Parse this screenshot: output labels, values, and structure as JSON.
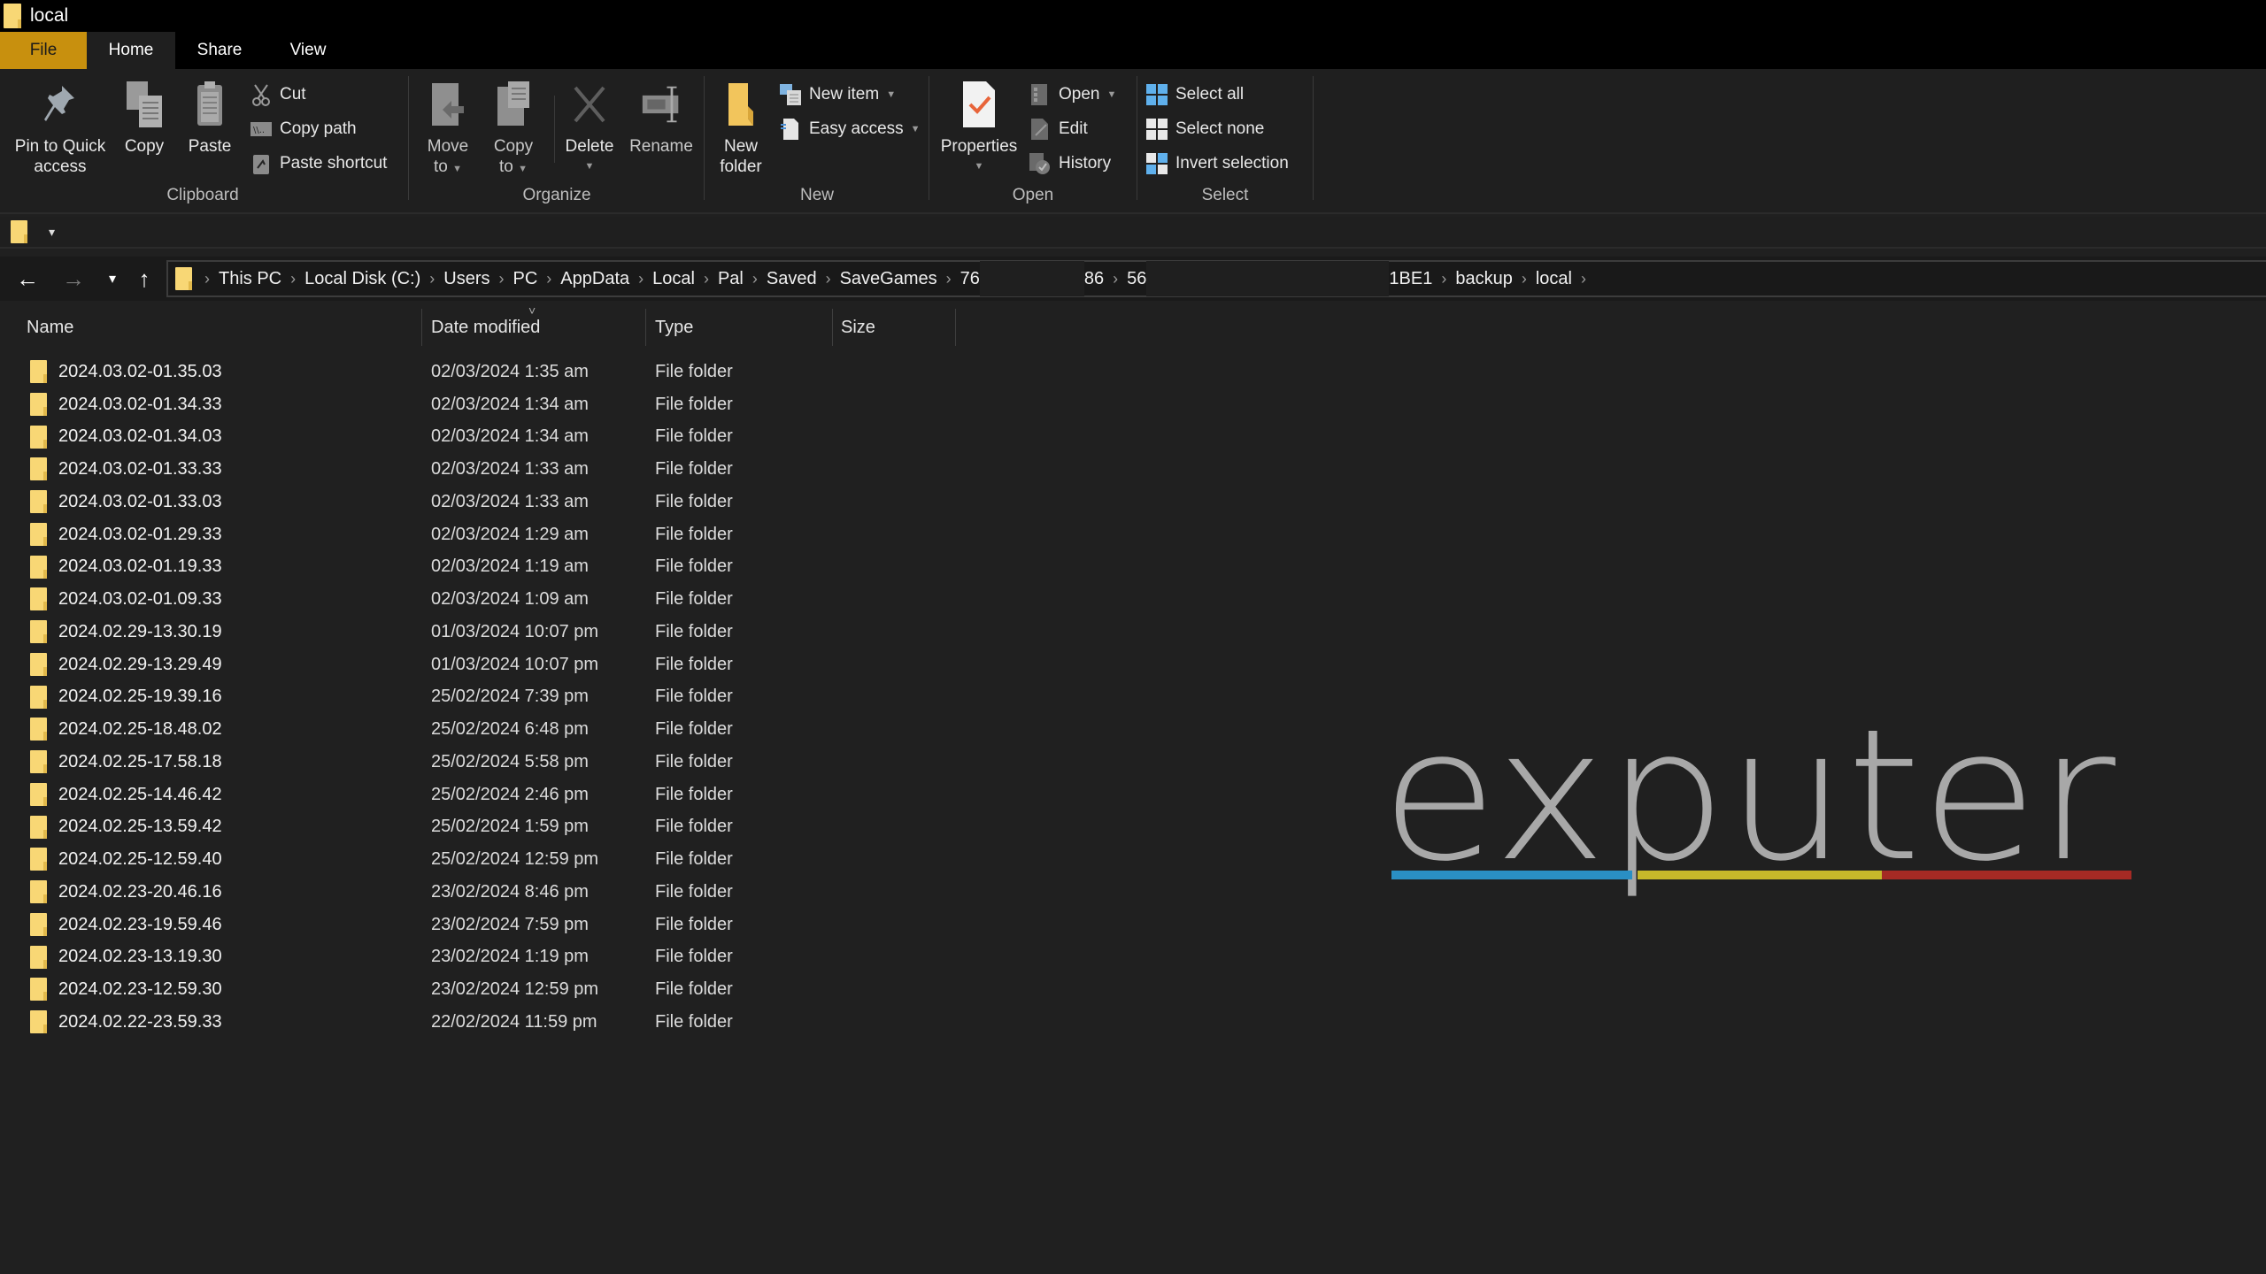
{
  "window": {
    "title": "local"
  },
  "tabs": [
    {
      "label": "File",
      "active": false,
      "accent": "#c8900e"
    },
    {
      "label": "Home",
      "active": true
    },
    {
      "label": "Share",
      "active": false
    },
    {
      "label": "View",
      "active": false
    }
  ],
  "ribbon": {
    "clipboard": {
      "label": "Clipboard",
      "pin_line1": "Pin to Quick",
      "pin_line2": "access",
      "copy": "Copy",
      "paste": "Paste",
      "cut": "Cut",
      "copy_path": "Copy path",
      "paste_shortcut": "Paste shortcut"
    },
    "organize": {
      "label": "Organize",
      "move_line1": "Move",
      "move_line2": "to",
      "copy_line1": "Copy",
      "copy_line2": "to",
      "delete": "Delete",
      "rename": "Rename"
    },
    "new": {
      "label": "New",
      "new_folder_line1": "New",
      "new_folder_line2": "folder",
      "new_item": "New item",
      "easy_access": "Easy access"
    },
    "open": {
      "label": "Open",
      "properties": "Properties",
      "open": "Open",
      "edit": "Edit",
      "history": "History"
    },
    "select": {
      "label": "Select",
      "select_all": "Select all",
      "select_none": "Select none",
      "invert_selection": "Invert selection"
    }
  },
  "address": {
    "crumbs": [
      "This PC",
      "Local Disk (C:)",
      "Users",
      "PC",
      "AppData",
      "Local",
      "Pal",
      "Saved",
      "SaveGames",
      "76",
      "86",
      "56",
      "1BE1",
      "backup",
      "local"
    ]
  },
  "columns": {
    "name": "Name",
    "date": "Date modified",
    "type": "Type",
    "size": "Size"
  },
  "files": [
    {
      "name": "2024.03.02-01.35.03",
      "date": "02/03/2024 1:35 am",
      "type": "File folder"
    },
    {
      "name": "2024.03.02-01.34.33",
      "date": "02/03/2024 1:34 am",
      "type": "File folder"
    },
    {
      "name": "2024.03.02-01.34.03",
      "date": "02/03/2024 1:34 am",
      "type": "File folder"
    },
    {
      "name": "2024.03.02-01.33.33",
      "date": "02/03/2024 1:33 am",
      "type": "File folder"
    },
    {
      "name": "2024.03.02-01.33.03",
      "date": "02/03/2024 1:33 am",
      "type": "File folder"
    },
    {
      "name": "2024.03.02-01.29.33",
      "date": "02/03/2024 1:29 am",
      "type": "File folder"
    },
    {
      "name": "2024.03.02-01.19.33",
      "date": "02/03/2024 1:19 am",
      "type": "File folder"
    },
    {
      "name": "2024.03.02-01.09.33",
      "date": "02/03/2024 1:09 am",
      "type": "File folder"
    },
    {
      "name": "2024.02.29-13.30.19",
      "date": "01/03/2024 10:07 pm",
      "type": "File folder"
    },
    {
      "name": "2024.02.29-13.29.49",
      "date": "01/03/2024 10:07 pm",
      "type": "File folder"
    },
    {
      "name": "2024.02.25-19.39.16",
      "date": "25/02/2024 7:39 pm",
      "type": "File folder"
    },
    {
      "name": "2024.02.25-18.48.02",
      "date": "25/02/2024 6:48 pm",
      "type": "File folder"
    },
    {
      "name": "2024.02.25-17.58.18",
      "date": "25/02/2024 5:58 pm",
      "type": "File folder"
    },
    {
      "name": "2024.02.25-14.46.42",
      "date": "25/02/2024 2:46 pm",
      "type": "File folder"
    },
    {
      "name": "2024.02.25-13.59.42",
      "date": "25/02/2024 1:59 pm",
      "type": "File folder"
    },
    {
      "name": "2024.02.25-12.59.40",
      "date": "25/02/2024 12:59 pm",
      "type": "File folder"
    },
    {
      "name": "2024.02.23-20.46.16",
      "date": "23/02/2024 8:46 pm",
      "type": "File folder"
    },
    {
      "name": "2024.02.23-19.59.46",
      "date": "23/02/2024 7:59 pm",
      "type": "File folder"
    },
    {
      "name": "2024.02.23-13.19.30",
      "date": "23/02/2024 1:19 pm",
      "type": "File folder"
    },
    {
      "name": "2024.02.23-12.59.30",
      "date": "23/02/2024 12:59 pm",
      "type": "File folder"
    },
    {
      "name": "2024.02.22-23.59.33",
      "date": "22/02/2024 11:59 pm",
      "type": "File folder"
    }
  ],
  "watermark": {
    "text": "exputer",
    "colors": [
      "#2a8fc4",
      "#c7b92a",
      "#a52a24"
    ]
  }
}
